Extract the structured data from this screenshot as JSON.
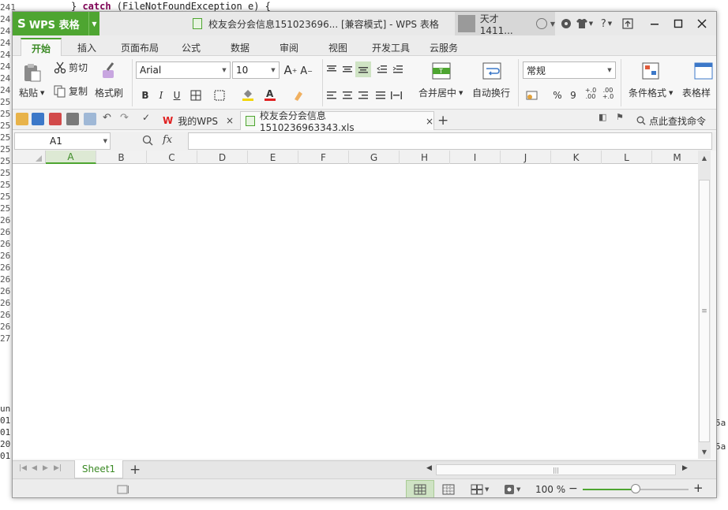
{
  "background_ide": {
    "line_numbers": [
      "241",
      "24",
      "24",
      "24",
      "24",
      "24",
      "24",
      "24",
      "25",
      "25",
      "25",
      "25",
      "25",
      "25",
      "25",
      "25",
      "25",
      "25",
      "26",
      "26",
      "26",
      "26",
      "26",
      "26",
      "26",
      "26",
      "26",
      "26",
      "27"
    ],
    "code_line": "} catch (FileNotFoundException e) {",
    "code_keyword": "catch",
    "bottom_fragments": [
      "un",
      "01",
      "01",
      "20",
      "01"
    ],
    "right_fragments": [
      "5a",
      "5a"
    ]
  },
  "titlebar": {
    "app_name": "WPS 表格",
    "app_logo": "S",
    "doc_title": "校友会分会信息151023696... [兼容模式] - WPS 表格",
    "user_name": "天才1411...",
    "icons": [
      "skin-icon",
      "shirt-icon",
      "help-icon",
      "upload-icon"
    ],
    "help_label": "?"
  },
  "ribbon_tabs": [
    "开始",
    "插入",
    "页面布局",
    "公式",
    "数据",
    "审阅",
    "视图",
    "开发工具",
    "云服务"
  ],
  "ribbon": {
    "paste": "粘贴",
    "cut": "剪切",
    "copy": "复制",
    "format_painter": "格式刷",
    "font_name": "Arial",
    "font_size": "10",
    "bold": "B",
    "italic": "I",
    "underline": "U",
    "merge_center": "合并居中",
    "wrap_text": "自动换行",
    "number_format": "常规",
    "percent": "%",
    "comma": "9",
    "inc_decimal": "+.0\n.00",
    "dec_decimal": ".00\n+.0",
    "conditional_format": "条件格式",
    "table_format": "表格样",
    "font_grow": "A",
    "font_shrink": "A"
  },
  "quickbar": {
    "tabs": [
      {
        "label": "我的WPS",
        "close": "×"
      },
      {
        "label": "校友会分会信息1510236963343.xls",
        "close": "×"
      }
    ],
    "add_tab": "+",
    "search_label": "点此查找命令"
  },
  "formula_bar": {
    "cell_ref": "A1",
    "fx": "fx",
    "value": ""
  },
  "columns": [
    "A",
    "B",
    "C",
    "D",
    "E",
    "F",
    "G",
    "H",
    "I",
    "J",
    "K",
    "L",
    "M"
  ],
  "selected_column": "A",
  "sheet_tabs": [
    {
      "label": "Sheet1",
      "active": true
    }
  ],
  "add_sheet": "+",
  "status": {
    "zoom": "100 %",
    "zoom_level": 0.5,
    "zoom_minus": "−",
    "zoom_plus": "+"
  },
  "colors": {
    "brand_green": "#4ea531",
    "text_green": "#3b8a25"
  }
}
